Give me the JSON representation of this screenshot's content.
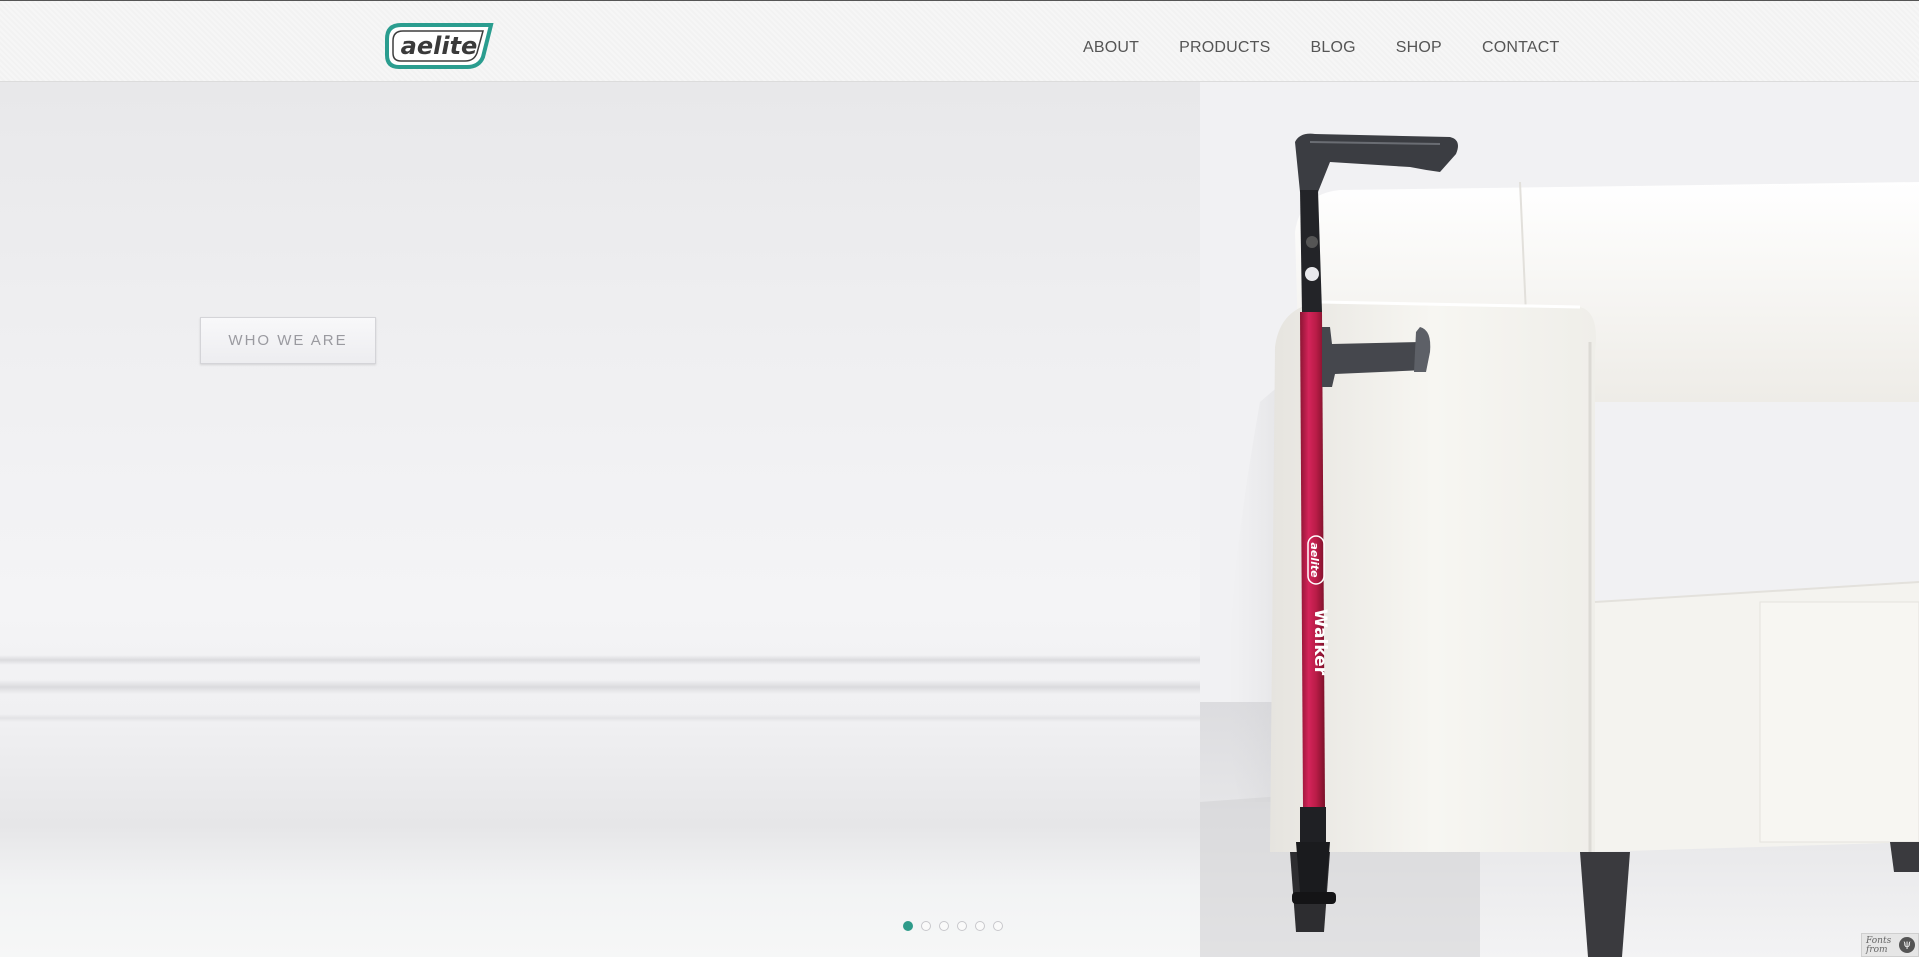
{
  "header": {
    "logo_text": "aelite",
    "nav": [
      {
        "label": "ABOUT"
      },
      {
        "label": "PRODUCTS"
      },
      {
        "label": "BLOG"
      },
      {
        "label": "SHOP"
      },
      {
        "label": "CONTACT"
      }
    ]
  },
  "hero": {
    "cta_label": "WHO WE ARE",
    "product_brand": "aelite",
    "product_name": "Walker",
    "slider": {
      "total_slides": 6,
      "active_index": 0
    }
  },
  "badge": {
    "line1": "Fonts",
    "line2": "from",
    "icon": "fonts-provider-icon"
  },
  "colors": {
    "accent": "#2e9b8a",
    "nav_text": "#555555",
    "cane_red": "#c41e4a",
    "header_bg": "#f4f4f4"
  }
}
